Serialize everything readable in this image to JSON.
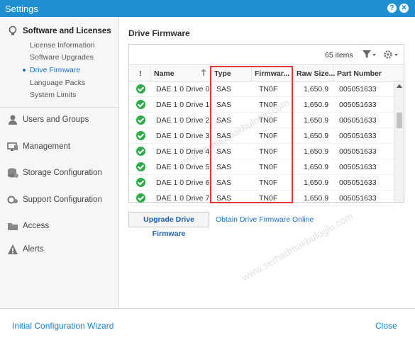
{
  "window": {
    "title": "Settings",
    "help_glyph": "?",
    "close_glyph": "✕"
  },
  "sidebar": {
    "software": {
      "label": "Software and Licenses",
      "items": [
        "License Information",
        "Software Upgrades",
        "Drive Firmware",
        "Language Packs",
        "System Limits"
      ],
      "active": "Drive Firmware"
    },
    "sections": [
      {
        "label": "Users and Groups",
        "icon": "user-icon"
      },
      {
        "label": "Management",
        "icon": "monitor-icon"
      },
      {
        "label": "Storage Configuration",
        "icon": "storage-icon"
      },
      {
        "label": "Support Configuration",
        "icon": "support-icon"
      },
      {
        "label": "Access",
        "icon": "folder-icon"
      },
      {
        "label": "Alerts",
        "icon": "warning-icon"
      }
    ]
  },
  "main": {
    "title": "Drive Firmware",
    "grid": {
      "count_label": "65 items",
      "columns": [
        "!",
        "Name",
        "Type",
        "Firmwar...",
        "Raw Size...",
        "Part Number"
      ],
      "rows": [
        {
          "status": "ok",
          "name": "DAE 1 0 Drive 0",
          "type": "SAS",
          "firmware": "TN0F",
          "raw_size": "1,650.9",
          "part_number": "005051633"
        },
        {
          "status": "ok",
          "name": "DAE 1 0 Drive 1",
          "type": "SAS",
          "firmware": "TN0F",
          "raw_size": "1,650.9",
          "part_number": "005051633"
        },
        {
          "status": "ok",
          "name": "DAE 1 0 Drive 2",
          "type": "SAS",
          "firmware": "TN0F",
          "raw_size": "1,650.9",
          "part_number": "005051633"
        },
        {
          "status": "ok",
          "name": "DAE 1 0 Drive 3",
          "type": "SAS",
          "firmware": "TN0F",
          "raw_size": "1,650.9",
          "part_number": "005051633"
        },
        {
          "status": "ok",
          "name": "DAE 1 0 Drive 4",
          "type": "SAS",
          "firmware": "TN0F",
          "raw_size": "1,650.9",
          "part_number": "005051633"
        },
        {
          "status": "ok",
          "name": "DAE 1 0 Drive 5",
          "type": "SAS",
          "firmware": "TN0F",
          "raw_size": "1,650.9",
          "part_number": "005051633"
        },
        {
          "status": "ok",
          "name": "DAE 1 0 Drive 6",
          "type": "SAS",
          "firmware": "TN0F",
          "raw_size": "1,650.9",
          "part_number": "005051633"
        },
        {
          "status": "ok",
          "name": "DAE 1 0 Drive 7",
          "type": "SAS",
          "firmware": "TN0F",
          "raw_size": "1,650.9",
          "part_number": "005051633"
        }
      ]
    },
    "upgrade_button": "Upgrade Drive Firmware",
    "online_link": "Obtain Drive Firmware Online"
  },
  "footer": {
    "wizard_link": "Initial Configuration Wizard",
    "close_label": "Close"
  },
  "watermark": "www.serhadmakbuloglu.com",
  "colors": {
    "titlebar": "#1f8fd1",
    "ok": "#2eaa4a",
    "highlight_box": "#e0393b",
    "link": "#1f7fcf"
  }
}
